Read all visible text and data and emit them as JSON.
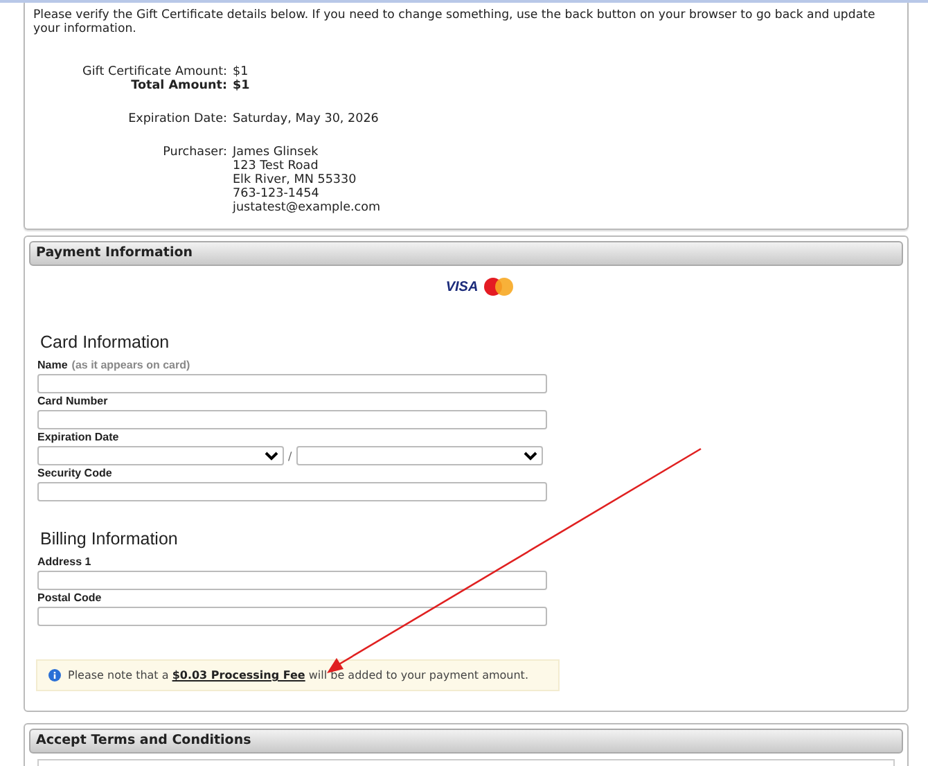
{
  "intro": "Please verify the Gift Certificate details below. If you need to change something, use the back button on your browser to go back and update your information.",
  "summary": [
    {
      "rows": [
        {
          "label": "Gift Certificate Amount:",
          "value": [
            "$1"
          ],
          "kind": "plain"
        },
        {
          "label": "Total Amount:",
          "value": [
            "$1"
          ],
          "kind": "bold"
        }
      ]
    },
    {
      "rows": [
        {
          "label": "Expiration Date:",
          "value": [
            "Saturday, May 30, 2026"
          ],
          "kind": "plain"
        }
      ]
    },
    {
      "rows": [
        {
          "label": "Purchaser:",
          "value": [
            "James Glinsek",
            "123 Test Road",
            "Elk River, MN 55330",
            "763-123-1454",
            "justatest@example.com"
          ],
          "kind": "plain"
        }
      ]
    }
  ],
  "payment": {
    "title": "Payment Information",
    "card_logo": "VISA",
    "sections": [
      {
        "heading": "Card Information",
        "fields": [
          {
            "kind": "text",
            "label": "Name",
            "hint": "(as it appears on card)"
          },
          {
            "kind": "text",
            "label": "Card Number"
          },
          {
            "kind": "date",
            "label": "Expiration Date",
            "separator": "/"
          },
          {
            "kind": "text",
            "label": "Security Code"
          }
        ]
      },
      {
        "heading": "Billing Information",
        "fields": [
          {
            "kind": "text",
            "label": "Address 1"
          },
          {
            "kind": "text",
            "label": "Postal Code"
          }
        ]
      }
    ],
    "notice": "Please note that a **$0.03 Processing Fee** will be added to your payment amount."
  },
  "terms": {
    "title": "Accept Terms and Conditions"
  }
}
